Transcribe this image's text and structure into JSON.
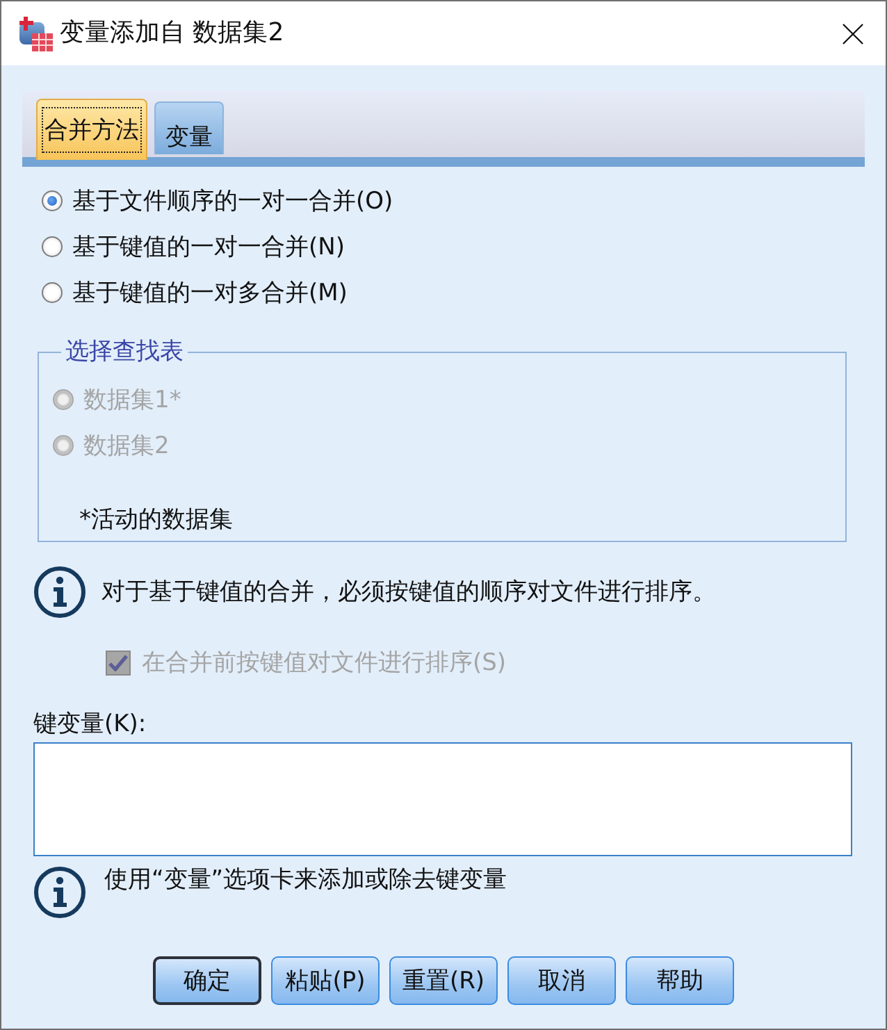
{
  "window": {
    "title": "变量添加自 数据集2"
  },
  "tabs": [
    {
      "label": "合并方法",
      "selected": true
    },
    {
      "label": "变量",
      "selected": false
    }
  ],
  "merge_methods": [
    {
      "label": "基于文件顺序的一对一合并(O)",
      "selected": true
    },
    {
      "label": "基于键值的一对一合并(N)",
      "selected": false
    },
    {
      "label": "基于键值的一对多合并(M)",
      "selected": false
    }
  ],
  "lookup_table": {
    "title": "选择查找表",
    "options": [
      {
        "label": "数据集1*",
        "selected": false,
        "disabled": true
      },
      {
        "label": "数据集2",
        "selected": false,
        "disabled": true
      }
    ],
    "note": "*活动的数据集"
  },
  "sort_notice": {
    "text": "对于基于键值的合并，必须按键值的顺序对文件进行排序。"
  },
  "sort_checkbox": {
    "label": "在合并前按键值对文件进行排序(S)",
    "checked": true,
    "disabled": true
  },
  "key_variables": {
    "label": "键变量(K):"
  },
  "key_hint": {
    "text": "使用“变量”选项卡来添加或除去键变量"
  },
  "buttons": [
    {
      "label": "确定",
      "default": true
    },
    {
      "label": "粘贴(P)",
      "default": false
    },
    {
      "label": "重置(R)",
      "default": false
    },
    {
      "label": "取消",
      "default": false
    },
    {
      "label": "帮助",
      "default": false
    }
  ]
}
